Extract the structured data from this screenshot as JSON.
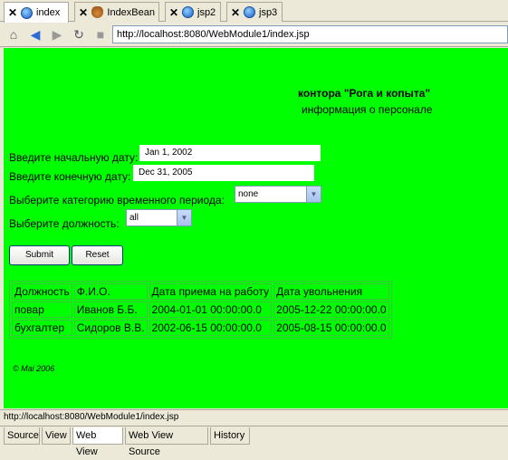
{
  "tabs": [
    {
      "label": "index",
      "icon": "globe-icon"
    },
    {
      "label": "IndexBean",
      "icon": "bean-icon"
    },
    {
      "label": "jsp2",
      "icon": "globe-icon"
    },
    {
      "label": "jsp3",
      "icon": "globe-icon"
    }
  ],
  "toolbar": {
    "url": "http://localhost:8080/WebModule1/index.jsp"
  },
  "page": {
    "title": "контора \"Рога и копыта\"",
    "subtitle": "информация о персонале",
    "start_label": "Введите начальную дату:",
    "start_value": "Jan 1, 2002",
    "end_label": "Введите конечную дату:",
    "end_value": "Dec 31, 2005",
    "period_label": "Выберите категорию временного периода:",
    "period_value": "none",
    "position_label": "Выберите должность:",
    "position_value": "all",
    "submit": "Submit",
    "reset": "Reset",
    "table": {
      "headers": [
        "Должность",
        "Ф.И.О.",
        "Дата приема на работу",
        "Дата увольнения"
      ],
      "rows": [
        [
          "повар",
          "Иванов Б.Б.",
          "2004-01-01 00:00:00.0",
          "2005-12-22 00:00:00.0"
        ],
        [
          "бухгалтер",
          "Сидоров В.В.",
          "2002-06-15 00:00:00.0",
          "2005-08-15 00:00:00.0"
        ]
      ]
    },
    "copyright": "©   Mai    2006"
  },
  "status_text": "http://localhost:8080/WebModule1/index.jsp",
  "bottom_tabs": [
    "Source",
    "View",
    "Web View",
    "Web View Source",
    "History"
  ],
  "colors": {
    "page_background": "#00ff00"
  }
}
